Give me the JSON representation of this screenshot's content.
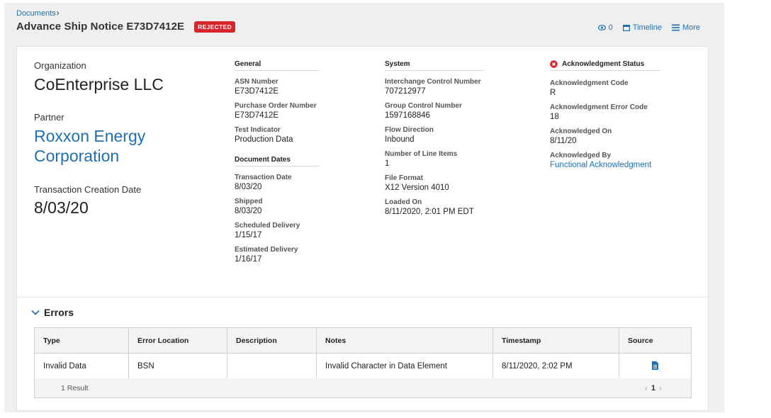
{
  "breadcrumb": {
    "documents": "Documents",
    "separator": "›"
  },
  "header": {
    "title": "Advance Ship Notice E73D7412E",
    "status": "REJECTED"
  },
  "actions": {
    "views_count": "0",
    "timeline": "Timeline",
    "more": "More"
  },
  "summary": {
    "organization_label": "Organization",
    "organization": "CoEnterprise LLC",
    "partner_label": "Partner",
    "partner": "Roxxon Energy Corporation",
    "tcd_label": "Transaction Creation Date",
    "tcd": "8/03/20"
  },
  "general": {
    "heading": "General",
    "fields": [
      {
        "label": "ASN Number",
        "value": "E73D7412E"
      },
      {
        "label": "Purchase Order Number",
        "value": "E73D7412E"
      },
      {
        "label": "Test Indicator",
        "value": "Production Data"
      }
    ]
  },
  "dates": {
    "heading": "Document Dates",
    "fields": [
      {
        "label": "Transaction Date",
        "value": "8/03/20"
      },
      {
        "label": "Shipped",
        "value": "8/03/20"
      },
      {
        "label": "Scheduled Delivery",
        "value": "1/15/17"
      },
      {
        "label": "Estimated Delivery",
        "value": "1/16/17"
      }
    ]
  },
  "system": {
    "heading": "System",
    "fields": [
      {
        "label": "Interchange Control Number",
        "value": "707212977"
      },
      {
        "label": "Group Control Number",
        "value": "1597168846"
      },
      {
        "label": "Flow Direction",
        "value": "Inbound"
      },
      {
        "label": "Number of Line Items",
        "value": "1"
      },
      {
        "label": "File Format",
        "value": "X12 Version 4010"
      },
      {
        "label": "Loaded On",
        "value": "8/11/2020, 2:01 PM EDT"
      }
    ]
  },
  "ack": {
    "heading": "Acknowledgment Status",
    "fields": [
      {
        "label": "Acknowledgment Code",
        "value": "R"
      },
      {
        "label": "Acknowledgment Error Code",
        "value": "18"
      },
      {
        "label": "Acknowledged On",
        "value": "8/11/20"
      },
      {
        "label": "Acknowledged By",
        "value": "Functional Acknowledgment"
      }
    ]
  },
  "errors": {
    "heading": "Errors",
    "columns": [
      "Type",
      "Error Location",
      "Description",
      "Notes",
      "Timestamp",
      "Source"
    ],
    "rows": [
      {
        "type": "Invalid Data",
        "location": "BSN",
        "description": "",
        "notes": "Invalid Character in Data Element",
        "timestamp": "8/11/2020, 2:02 PM"
      }
    ],
    "result_count": "1 Result",
    "page": "1"
  },
  "colors": {
    "link": "#1f6fb2",
    "rejected": "#d7262b",
    "page_bg": "#efefef"
  }
}
